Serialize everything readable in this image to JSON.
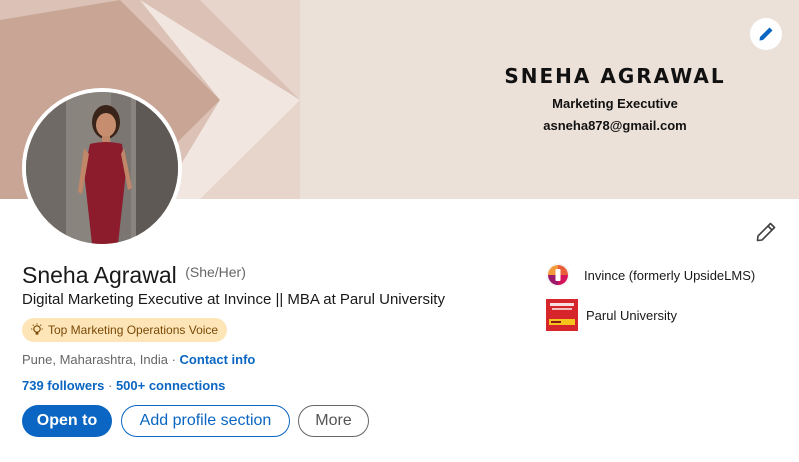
{
  "banner": {
    "name": "SNEHA AGRAWAL",
    "role": "Marketing Executive",
    "email": "asneha878@gmail.com",
    "background_color": "#ece1d9"
  },
  "profile": {
    "name": "Sneha Agrawal",
    "pronouns": "(She/Her)",
    "headline": "Digital Marketing Executive at Invince || MBA at Parul University",
    "badge": "Top Marketing Operations Voice",
    "location": "Pune, Maharashtra, India",
    "location_sep": " · ",
    "contact_info": "Contact info",
    "followers": "739 followers",
    "conn_sep": " · ",
    "connections": "500+ connections"
  },
  "buttons": {
    "open_to": "Open to",
    "add_section": "Add profile section",
    "more": "More"
  },
  "organizations": [
    {
      "name": "Invince (formerly UpsideLMS)",
      "icon": "invince-logo"
    },
    {
      "name": "Parul University",
      "icon": "parul-university-logo"
    }
  ],
  "colors": {
    "accent": "#0a66c2",
    "badge_bg": "#fde5b8",
    "badge_text": "#7a4a06"
  }
}
